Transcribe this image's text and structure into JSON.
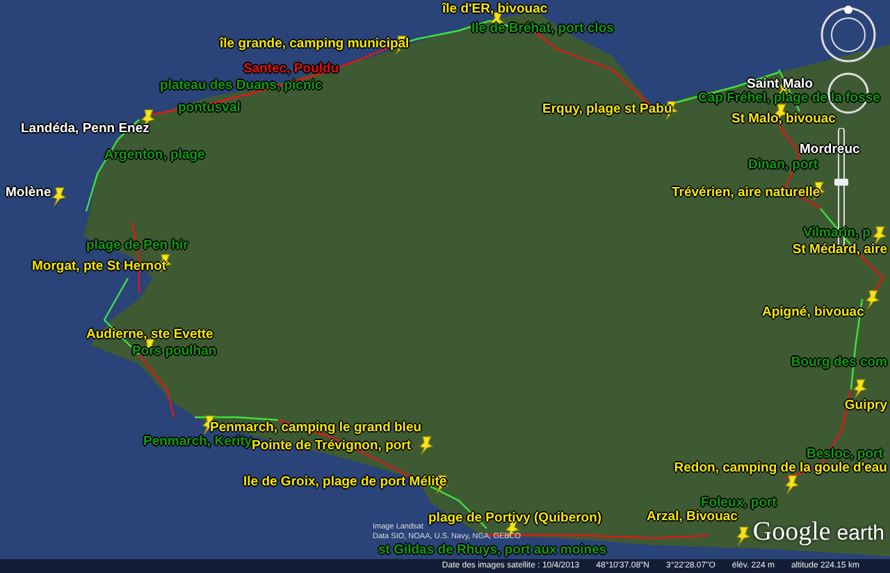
{
  "placemarks": [
    {
      "label": "île d'ER, bivouac",
      "color": "#f2e600",
      "pin": true
    },
    {
      "label": "Ile de Bréhat, port clos",
      "color": "#109a10",
      "pin": false
    },
    {
      "label": "île grande, camping municipal",
      "color": "#f2e600",
      "pin": true
    },
    {
      "label": "Santec, Pouldu",
      "color": "#e01010",
      "pin": false
    },
    {
      "label": "plateau des Duans, picnic",
      "color": "#109a10",
      "pin": false
    },
    {
      "label": "pontusval",
      "color": "#109a10",
      "pin": false
    },
    {
      "label": "Landéda, Penn Enez",
      "color": "#ffffff",
      "pin": true
    },
    {
      "label": "Argenton, plage",
      "color": "#109a10",
      "pin": false
    },
    {
      "label": "Molène",
      "color": "#ffffff",
      "pin": true
    },
    {
      "label": "plage de Pen hir",
      "color": "#109a10",
      "pin": false
    },
    {
      "label": "Morgat, pte St Hernot",
      "color": "#f2e600",
      "pin": true
    },
    {
      "label": "Audierne, ste Evette",
      "color": "#f2e600",
      "pin": true
    },
    {
      "label": "Pors poulhan",
      "color": "#109a10",
      "pin": false
    },
    {
      "label": "Penmarch, camping le grand bleu",
      "color": "#f2e600",
      "pin": true
    },
    {
      "label": "Penmarch, Kerity",
      "color": "#109a10",
      "pin": false
    },
    {
      "label": "Pointe de Trévignon, port",
      "color": "#f2e600",
      "pin": true
    },
    {
      "label": "Ile de Groix, plage de port Mélite",
      "color": "#f2e600",
      "pin": true
    },
    {
      "label": "plage de Portivy (Quiberon)",
      "color": "#f2e600",
      "pin": true
    },
    {
      "label": "st Gildas de Rhuys, port aux moines",
      "color": "#109a10",
      "pin": false
    },
    {
      "label": "Saint Malo",
      "color": "#ffffff",
      "pin": true
    },
    {
      "label": "Cap Fréhel, plage de la fosse",
      "color": "#109a10",
      "pin": false
    },
    {
      "label": "Erquy, plage st Pabu",
      "color": "#f2e600",
      "pin": true
    },
    {
      "label": "St Malo, bivouac",
      "color": "#f2e600",
      "pin": true
    },
    {
      "label": "Mordreuc",
      "color": "#ffffff",
      "pin": false
    },
    {
      "label": "Dinan, port",
      "color": "#109a10",
      "pin": false
    },
    {
      "label": "Trévérien, aire naturelle",
      "color": "#f2e600",
      "pin": true
    },
    {
      "label": "Vilmarin, p",
      "color": "#109a10",
      "pin": true
    },
    {
      "label": "St Médard, aire",
      "color": "#f2e600",
      "pin": false
    },
    {
      "label": "Apigné, bivouac",
      "color": "#f2e600",
      "pin": true
    },
    {
      "label": "Bourg des com",
      "color": "#109a10",
      "pin": false
    },
    {
      "label": "Guipry",
      "color": "#f2e600",
      "pin": true
    },
    {
      "label": "Besloc, port",
      "color": "#109a10",
      "pin": false
    },
    {
      "label": "Redon, camping de la goule d'eau",
      "color": "#f2e600",
      "pin": true
    },
    {
      "label": "Foleux, port",
      "color": "#109a10",
      "pin": false
    },
    {
      "label": "Arzal, Bivouac",
      "color": "#f2e600",
      "pin": true
    }
  ],
  "zoom_slider": {
    "level": 0.55
  },
  "logo": {
    "brand": "Google",
    "product": "earth"
  },
  "attribution": [
    "Image Landsat",
    "Data SIO, NOAA, U.S. Navy, NGA, GEBCO"
  ],
  "status_bar": [
    "Date des images satellite : 10/4/2013",
    "48°10'37.08\"N",
    "3°22'28.07\"O",
    "élév. 224 m",
    "altitude 224.15 km"
  ]
}
